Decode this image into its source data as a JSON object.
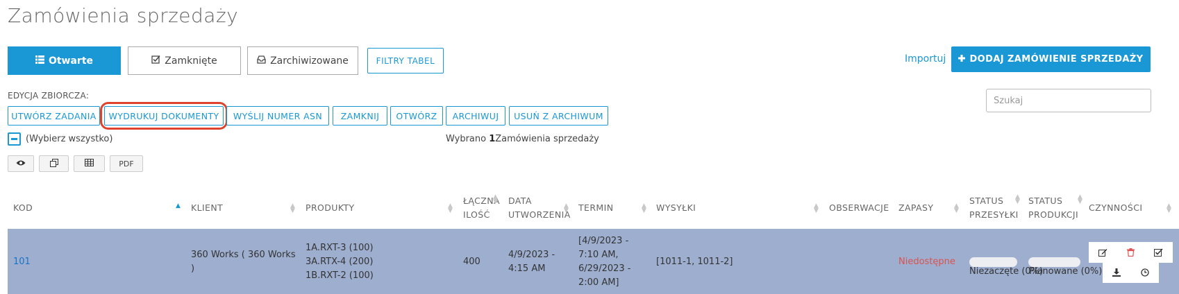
{
  "page": {
    "title": "Zamówienia sprzedaży"
  },
  "tabs": [
    {
      "label": "Otwarte",
      "icon": "list-icon",
      "active": true
    },
    {
      "label": "Zamknięte",
      "icon": "checkbox-icon",
      "active": false
    },
    {
      "label": "Zarchiwizowane",
      "icon": "inbox-icon",
      "active": false
    }
  ],
  "filters": {
    "label": "FILTRY TABEL"
  },
  "header_actions": {
    "import_label": "Importuj",
    "add_label": "DODAJ ZAMÓWIENIE SPRZEDAŻY"
  },
  "bulk": {
    "label": "EDYCJA ZBIORCZA:",
    "buttons": [
      "UTWÓRZ ZADANIA",
      "WYDRUKUJ DOKUMENTY",
      "WYŚLIJ NUMER ASN",
      "ZAMKNIJ",
      "OTWÓRZ",
      "ARCHIWUJ",
      "USUŃ Z ARCHIWUM"
    ]
  },
  "search": {
    "placeholder": "Szukaj"
  },
  "selection": {
    "select_all_label": "(Wybierz wszystko)",
    "prefix": "Wybrano ",
    "count": "1",
    "suffix": "Zamówienia sprzedaży"
  },
  "toolbar": {
    "pdf_label": "PDF"
  },
  "table": {
    "columns": {
      "code": "KOD",
      "client": "KLIENT",
      "products": "PRODUKTY",
      "qty": [
        "ŁĄCZNA",
        "ILOŚĆ"
      ],
      "created": [
        "DATA",
        "UTWORZENIA"
      ],
      "deadline": "TERMIN",
      "shipments": "WYSYŁKI",
      "observations": "OBSERWACJE",
      "stock": "ZAPASY",
      "shipping_status": [
        "STATUS",
        "PRZESYŁKI"
      ],
      "production_status": [
        "STATUS",
        "PRODUKCJI"
      ],
      "actions": "CZYNNOŚCI"
    },
    "rows": [
      {
        "code": "101",
        "client": [
          "360 Works ( 360 Works",
          ")"
        ],
        "products": [
          "1A.RXT-3 (100)",
          "3A.RTX-4 (200)",
          "1B.RXT-2 (100)"
        ],
        "qty": "400",
        "created": [
          "4/9/2023 -",
          "4:15 AM"
        ],
        "deadline": [
          "[4/9/2023 -",
          "7:10 AM,",
          "6/29/2023 -",
          "2:00 AM]"
        ],
        "shipments": "[1011-1, 1011-2]",
        "stock": "Niedostępne",
        "shipping_status": "Niezaczęte (0%)",
        "shipping_progress": 0,
        "production_status": "Planowane (0%)",
        "production_progress": 0
      }
    ]
  },
  "colors": {
    "accent": "#1a98d6",
    "row_selected": "#9eaecf",
    "danger": "#d9534f",
    "highlight": "#e0432b"
  }
}
